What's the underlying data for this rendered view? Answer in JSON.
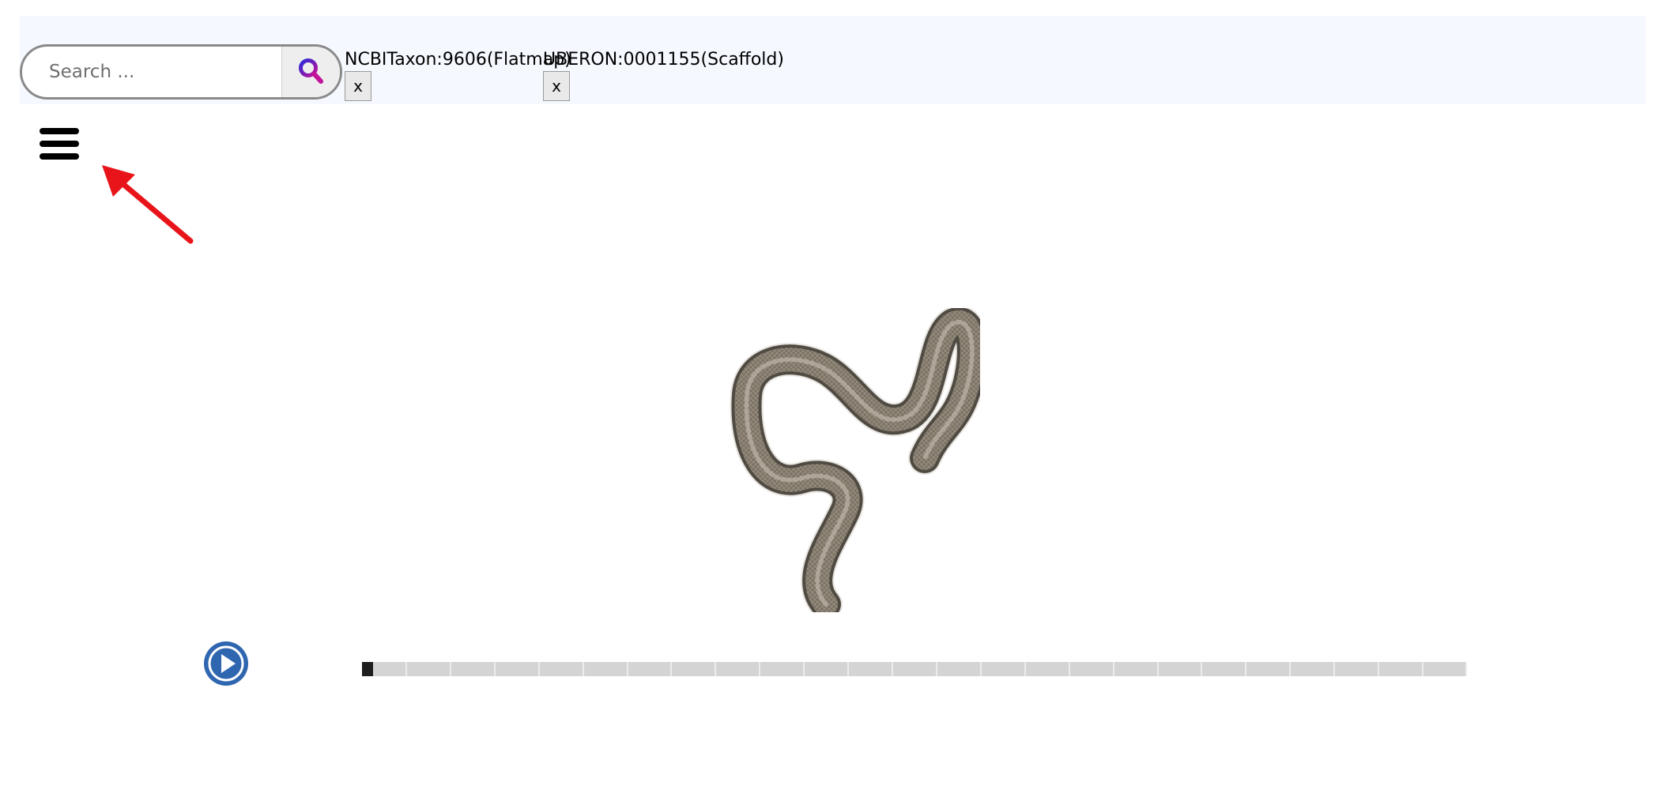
{
  "search": {
    "placeholder": "Search ...",
    "value": ""
  },
  "tags": [
    {
      "label": "NCBITaxon:9606(Flatmap)",
      "close": "x"
    },
    {
      "label": "UBERON:0001155(Scaffold)",
      "close": "x"
    }
  ],
  "icons": {
    "search": "search-icon",
    "menu": "hamburger-menu-icon",
    "play": "play-icon",
    "annotation": "red-arrow"
  },
  "timeline": {
    "segments": 25,
    "position": 0
  },
  "colors": {
    "search_icon": "#8a14d6",
    "play_button": "#2f66b0",
    "annotation_arrow": "#e8141a",
    "timeline_track": "#d4d4d4",
    "timeline_handle": "#1e1e1e"
  }
}
